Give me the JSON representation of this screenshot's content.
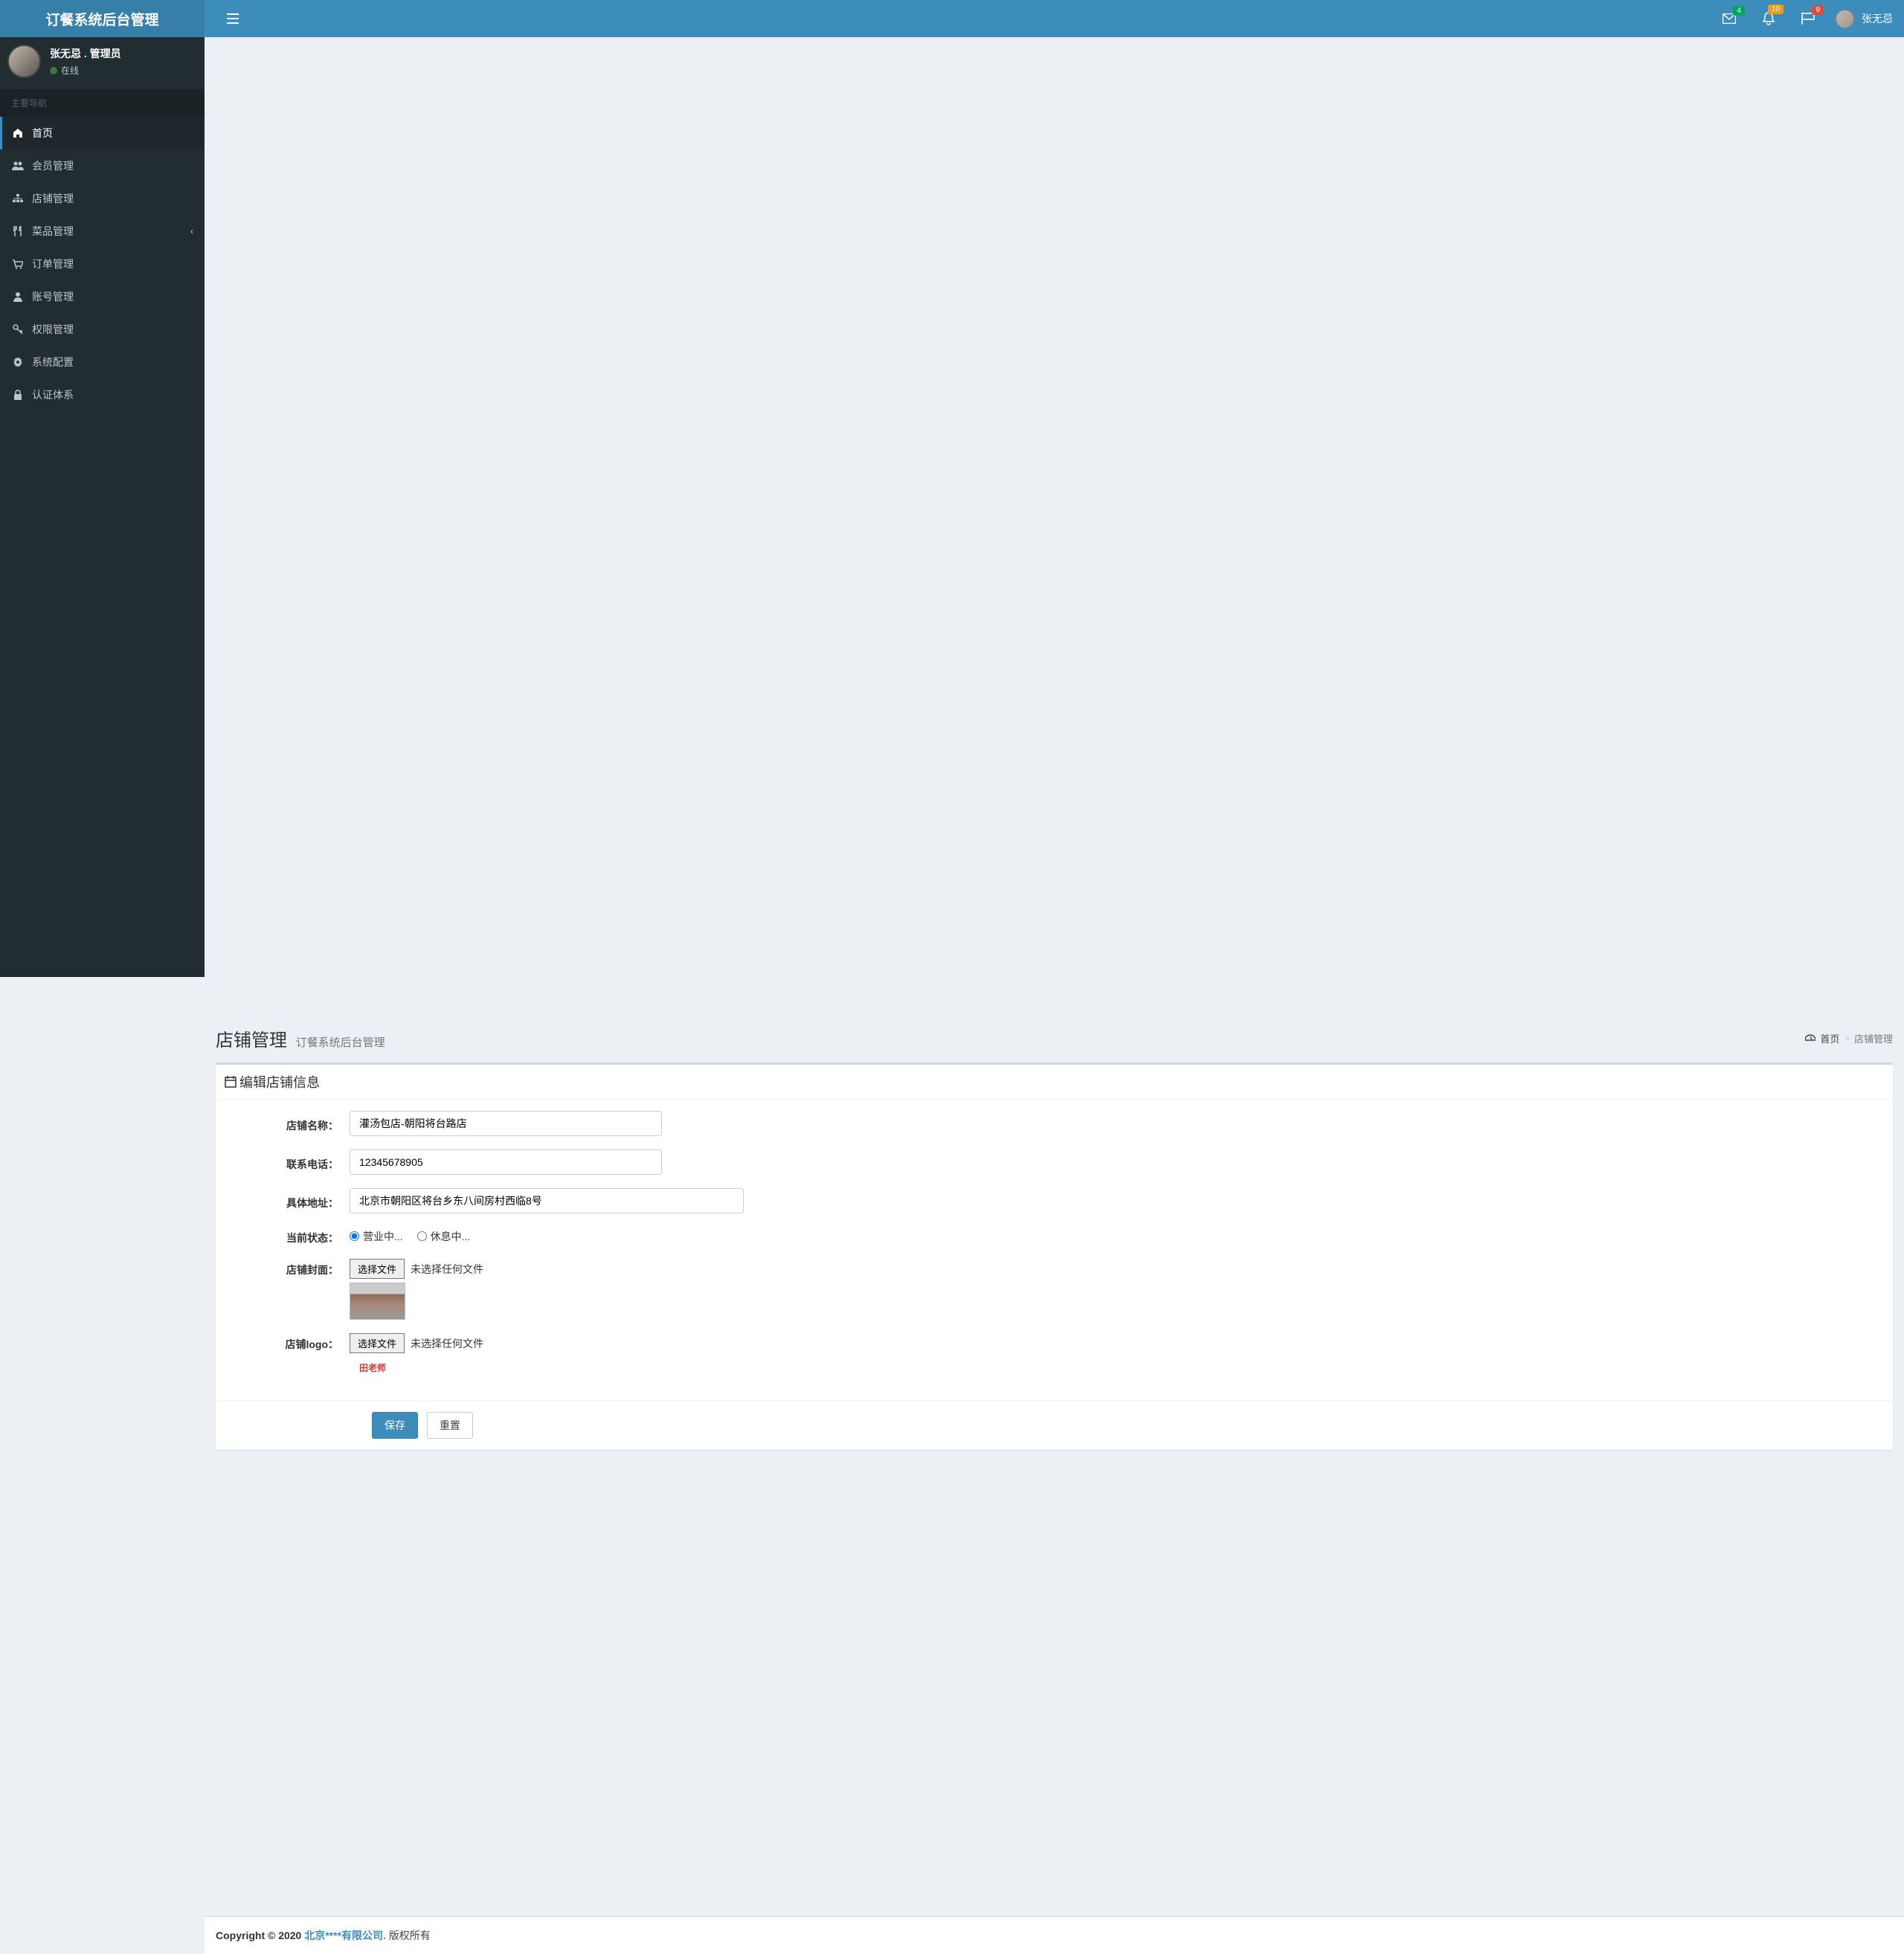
{
  "app": {
    "title": "订餐系统后台管理"
  },
  "header": {
    "badges": {
      "mail": "4",
      "bell": "10",
      "flag": "9"
    },
    "user_name": "张无忌"
  },
  "sidebar": {
    "user": {
      "name": "张无忌 . 管理员",
      "status": "在线"
    },
    "header": "主要导航",
    "items": [
      {
        "label": "首页"
      },
      {
        "label": "会员管理"
      },
      {
        "label": "店铺管理"
      },
      {
        "label": "菜品管理"
      },
      {
        "label": "订单管理"
      },
      {
        "label": "账号管理"
      },
      {
        "label": "权限管理"
      },
      {
        "label": "系统配置"
      },
      {
        "label": "认证体系"
      }
    ]
  },
  "page": {
    "title": "店铺管理",
    "subtitle": "订餐系统后台管理",
    "breadcrumb": {
      "home": "首页",
      "current": "店铺管理"
    }
  },
  "box": {
    "title": "编辑店铺信息"
  },
  "form": {
    "labels": {
      "name": "店铺名称：",
      "phone": "联系电话：",
      "address": "具体地址：",
      "status": "当前状态：",
      "cover": "店铺封面：",
      "logo": "店铺logo："
    },
    "values": {
      "name": "灌汤包店-朝阳将台路店",
      "phone": "12345678905",
      "address": "北京市朝阳区将台乡东八间房村西临8号"
    },
    "status_options": {
      "open": "营业中...",
      "closed": "休息中..."
    },
    "file": {
      "button": "选择文件",
      "none": "未选择任何文件"
    },
    "logo_text": "田老师",
    "buttons": {
      "save": "保存",
      "reset": "重置"
    }
  },
  "footer": {
    "copyright_prefix": "Copyright © 2020 ",
    "company": "北京****有限公司.",
    "suffix": " 版权所有"
  }
}
